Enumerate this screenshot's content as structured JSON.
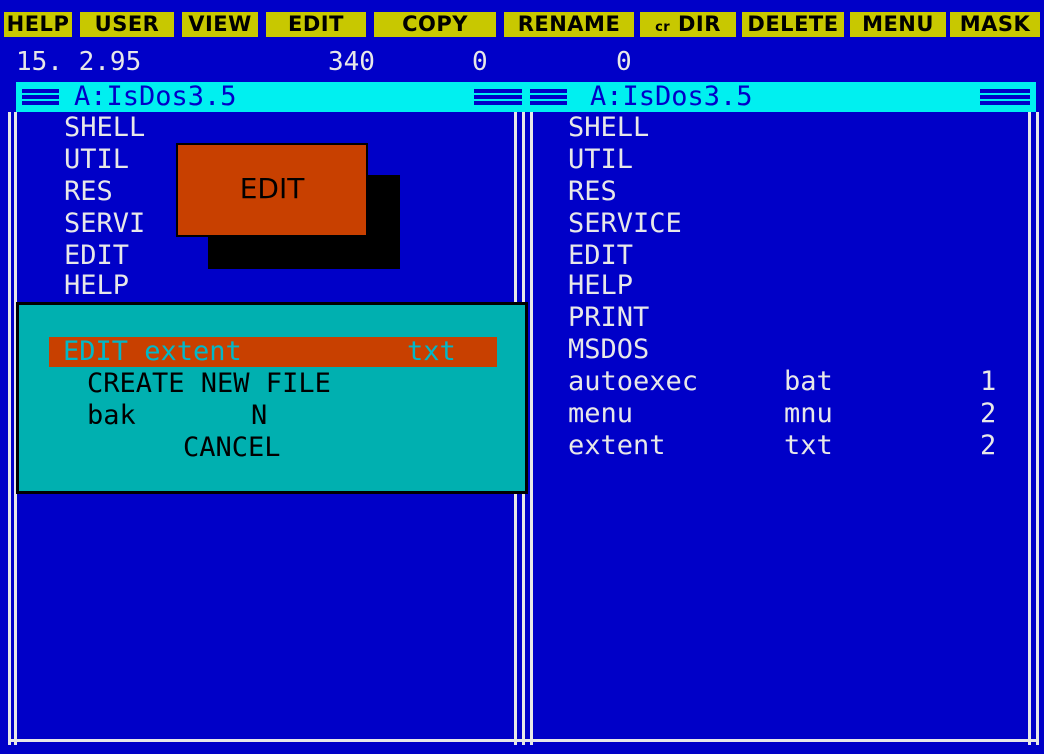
{
  "menubar": {
    "buttons": [
      {
        "label": "HELP"
      },
      {
        "label": "USER"
      },
      {
        "label": "VIEW"
      },
      {
        "label": "EDIT"
      },
      {
        "label": "COPY"
      },
      {
        "label": "RENAME"
      },
      {
        "label_small": "cr",
        "label": "DIR"
      },
      {
        "label": "DELETE"
      },
      {
        "label": "MENU"
      },
      {
        "label": "MASK"
      }
    ]
  },
  "status": {
    "date": "15. 2.95",
    "size": "340",
    "count1": "0",
    "count2": "0"
  },
  "left_panel": {
    "title": "A:IsDos3.5",
    "items": [
      "SHELL",
      "UTIL",
      "RES",
      "SERVI",
      "EDIT",
      "HELP"
    ]
  },
  "right_panel": {
    "title": "A:IsDos3.5",
    "items": [
      {
        "name": "SHELL",
        "ext": "",
        "size": ""
      },
      {
        "name": "UTIL",
        "ext": "",
        "size": ""
      },
      {
        "name": "RES",
        "ext": "",
        "size": ""
      },
      {
        "name": "SERVICE",
        "ext": "",
        "size": ""
      },
      {
        "name": "EDIT",
        "ext": "",
        "size": ""
      },
      {
        "name": "HELP",
        "ext": "",
        "size": ""
      },
      {
        "name": "PRINT",
        "ext": "",
        "size": ""
      },
      {
        "name": "MSDOS",
        "ext": "",
        "size": ""
      },
      {
        "name": "autoexec",
        "ext": "bat",
        "size": "1"
      },
      {
        "name": "menu",
        "ext": "mnu",
        "size": "2"
      },
      {
        "name": "extent",
        "ext": "txt",
        "size": "2"
      }
    ]
  },
  "edit_title": "EDIT",
  "dialog": {
    "selected_name": "EDIT extent",
    "selected_ext": "txt",
    "create_new": "CREATE NEW FILE",
    "bak_label": "bak",
    "bak_value": "N",
    "cancel": "CANCEL"
  },
  "colors": {
    "background": "#0000c8",
    "menu_button": "#c8c800",
    "header": "#00f0f0",
    "dialog": "#00b0b0",
    "highlight": "#c84000"
  }
}
